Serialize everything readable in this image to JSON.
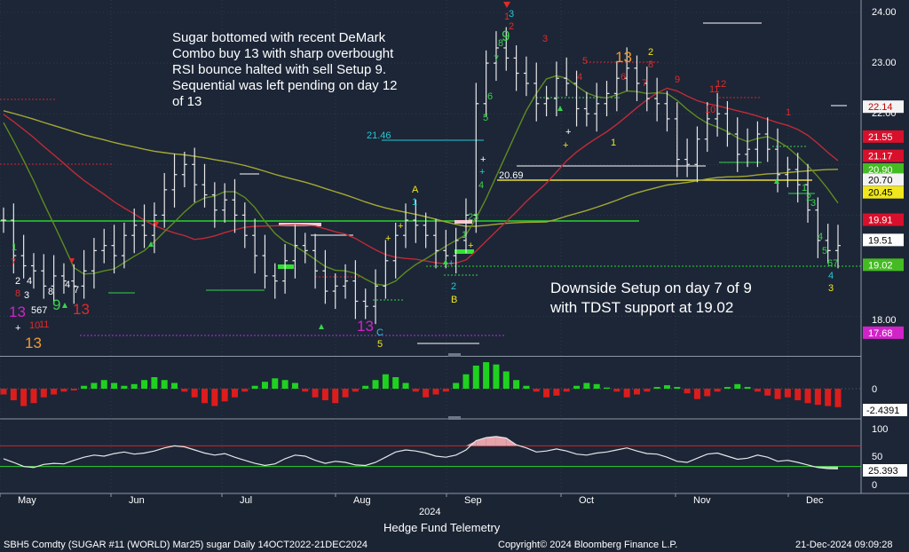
{
  "chart_data": {
    "type": "line",
    "title": "Hedge Fund Telemetry",
    "x_axis_year": "2024",
    "months": [
      "May",
      "Jun",
      "Jul",
      "Aug",
      "Sep",
      "Oct",
      "Nov",
      "Dec"
    ],
    "price_panel": {
      "ylim": [
        17.5,
        24.15
      ],
      "y_ticks": [
        "24.00",
        "23.00",
        "22.00",
        "18.00"
      ],
      "close_series": [
        19.9,
        19.2,
        19.0,
        18.9,
        18.6,
        18.8,
        18.7,
        18.6,
        18.9,
        19.3,
        19.4,
        19.2,
        19.6,
        19.8,
        19.6,
        20.0,
        20.5,
        20.8,
        21.0,
        20.6,
        20.4,
        20.1,
        20.3,
        20.0,
        19.6,
        19.2,
        18.8,
        18.7,
        19.1,
        19.4,
        19.3,
        18.9,
        18.5,
        18.6,
        18.7,
        18.3,
        18.2,
        18.6,
        19.1,
        19.6,
        19.9,
        19.8,
        19.6,
        19.3,
        19.2,
        19.5,
        20.0,
        22.2,
        23.0,
        23.3,
        23.1,
        22.8,
        22.6,
        22.2,
        22.3,
        22.7,
        22.6,
        22.1,
        22.0,
        22.2,
        22.4,
        22.7,
        22.9,
        22.6,
        22.3,
        22.2,
        21.9,
        21.1,
        21.0,
        21.5,
        21.9,
        22.0,
        21.6,
        21.2,
        21.3,
        21.6,
        21.3,
        20.8,
        20.9,
        20.6,
        20.1,
        19.5,
        19.3,
        19.4
      ],
      "series": [
        {
          "name": "Price (OHLC bars)",
          "color": "#e8e8e8"
        },
        {
          "name": "Moving average 1",
          "color": "#a5a832"
        },
        {
          "name": "Moving average 2",
          "color": "#c12a36"
        },
        {
          "name": "Moving average 3",
          "color": "#5f8a1f"
        }
      ],
      "price_tags": [
        {
          "label": "22.14",
          "value": 22.14,
          "bg": "#f3f3f3",
          "fg": "#c40000"
        },
        {
          "label": "21.55",
          "value": 21.55,
          "bg": "#d9102b",
          "fg": "#ffffff"
        },
        {
          "label": "21.17",
          "value": 21.17,
          "bg": "#d9102b",
          "fg": "#ffffff"
        },
        {
          "label": "20.90",
          "value": 20.9,
          "bg": "#44bb22",
          "fg": "#ffffff"
        },
        {
          "label": "20.70",
          "value": 20.7,
          "bg": "#f3f3f3",
          "fg": "#000000"
        },
        {
          "label": "20.45",
          "value": 20.45,
          "bg": "#f1e71c",
          "fg": "#000000"
        },
        {
          "label": "19.91",
          "value": 19.91,
          "bg": "#d9102b",
          "fg": "#ffffff"
        },
        {
          "label": "19.51",
          "value": 19.51,
          "bg": "#ffffff",
          "fg": "#000000"
        },
        {
          "label": "19.02",
          "value": 19.02,
          "bg": "#44bb22",
          "fg": "#ffffff"
        },
        {
          "label": "17.68",
          "value": 17.68,
          "bg": "#d223c9",
          "fg": "#ffffff"
        }
      ],
      "level_labels": [
        {
          "label": "21.46",
          "value": 21.46
        },
        {
          "label": "20.69",
          "value": 20.69
        }
      ]
    },
    "momentum_panel": {
      "y_ticks": [
        "0"
      ],
      "last_value": "-2.4391",
      "values": [
        -1,
        -2,
        -3,
        -2.5,
        -1.5,
        -1,
        -0.5,
        -0.3,
        0.5,
        1,
        1.5,
        1,
        0.5,
        0.8,
        1.5,
        2,
        1.5,
        1,
        -0.5,
        -1.5,
        -2.5,
        -3,
        -2.2,
        -1.5,
        -0.5,
        0.5,
        1.2,
        1.8,
        1.5,
        1,
        -0.5,
        -1.5,
        -2,
        -2.5,
        -1.5,
        -0.5,
        0.5,
        1.5,
        2.5,
        2,
        1,
        -0.5,
        -1.5,
        -1,
        -0.5,
        1,
        2.5,
        4,
        4.6,
        4.2,
        3,
        1.5,
        0.5,
        -0.5,
        -1.5,
        -1.2,
        -0.5,
        0.5,
        1,
        0.8,
        0.2,
        -0.5,
        -1.5,
        -1,
        -0.5,
        0.3,
        0.6,
        0.3,
        -0.8,
        -1.8,
        -1.3,
        -0.5,
        0.3,
        0.8,
        0.3,
        -0.5,
        -1.2,
        -1.8,
        -1.5,
        -2,
        -2.5,
        -2.8,
        -3,
        -3.2
      ]
    },
    "rsi_panel": {
      "y_ticks": [
        "100",
        "50",
        "0"
      ],
      "ylim": [
        -5,
        105
      ],
      "overbought": 70,
      "oversold": 30,
      "last_value": "25.393",
      "values": [
        45,
        38,
        30,
        28,
        34,
        36,
        35,
        42,
        48,
        52,
        50,
        55,
        58,
        54,
        56,
        60,
        66,
        70,
        68,
        62,
        56,
        52,
        55,
        48,
        42,
        36,
        32,
        35,
        45,
        52,
        50,
        42,
        36,
        40,
        38,
        33,
        32,
        38,
        48,
        58,
        62,
        60,
        56,
        50,
        48,
        52,
        62,
        80,
        86,
        88,
        85,
        72,
        66,
        58,
        60,
        64,
        60,
        54,
        52,
        56,
        58,
        62,
        66,
        60,
        55,
        54,
        48,
        40,
        38,
        46,
        54,
        56,
        50,
        44,
        46,
        52,
        48,
        40,
        42,
        38,
        33,
        28,
        26,
        25.4
      ]
    },
    "annotations": {
      "top_left": [
        "Sugar bottomed with recent DeMark",
        "Combo buy 13 with sharp overbought",
        "RSI bounce halted with sell Setup 9.",
        "Sequential was left pending on day 12",
        "of 13"
      ],
      "bottom_right": [
        "Downside Setup on day 7 of 9",
        "with TDST support at 19.02"
      ]
    },
    "footer": {
      "left": "SBH5 Comdty (SUGAR #11 (WORLD) Mar25) sugar  Daily 14OCT2022-21DEC2024",
      "center": "Copyright© 2024 Bloomberg Finance L.P.",
      "right": "21-Dec-2024 09:09:28"
    }
  }
}
